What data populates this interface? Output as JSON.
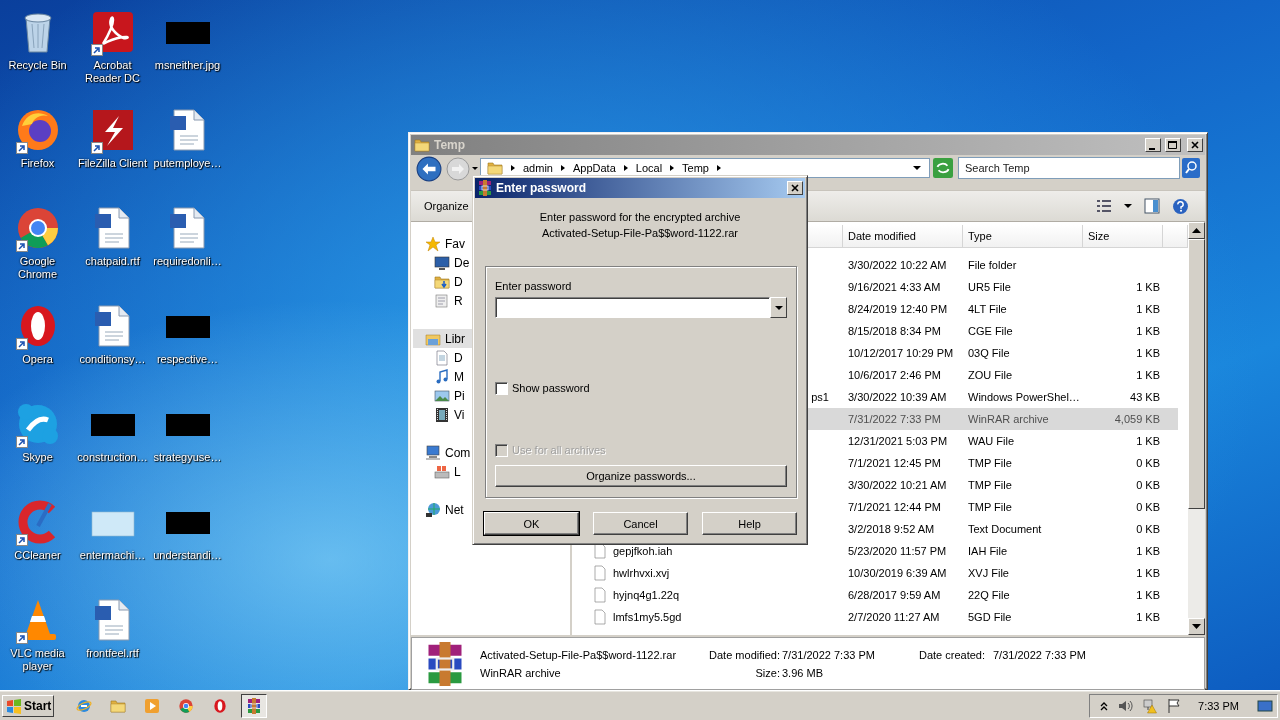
{
  "desktop": {
    "icons": [
      {
        "label": "Recycle Bin",
        "kind": "recycle",
        "shortcut": false
      },
      {
        "label": "Acrobat Reader DC",
        "kind": "acrobat",
        "shortcut": true
      },
      {
        "label": "msneither.jpg",
        "kind": "thumb",
        "shortcut": false
      },
      {
        "label": "Firefox",
        "kind": "firefox",
        "shortcut": true
      },
      {
        "label": "FileZilla Client",
        "kind": "filezilla",
        "shortcut": true
      },
      {
        "label": "putemploye…",
        "kind": "doc",
        "shortcut": false
      },
      {
        "label": "Google Chrome",
        "kind": "chrome",
        "shortcut": true
      },
      {
        "label": "chatpaid.rtf",
        "kind": "doc",
        "shortcut": false
      },
      {
        "label": "requiredonli…",
        "kind": "doc",
        "shortcut": false
      },
      {
        "label": "Opera",
        "kind": "opera",
        "shortcut": true
      },
      {
        "label": "conditionsy…",
        "kind": "doc",
        "shortcut": false
      },
      {
        "label": "respective…",
        "kind": "thumb",
        "shortcut": false
      },
      {
        "label": "Skype",
        "kind": "skype",
        "shortcut": true
      },
      {
        "label": "construction…",
        "kind": "thumb",
        "shortcut": false
      },
      {
        "label": "strategyuse…",
        "kind": "thumb",
        "shortcut": false
      },
      {
        "label": "CCleaner",
        "kind": "ccleaner",
        "shortcut": true
      },
      {
        "label": "entermachi…",
        "kind": "blank",
        "shortcut": false
      },
      {
        "label": "understandi…",
        "kind": "thumb",
        "shortcut": false
      },
      {
        "label": "VLC media player",
        "kind": "vlc",
        "shortcut": true
      },
      {
        "label": "frontfeel.rtf",
        "kind": "doc",
        "shortcut": false
      }
    ]
  },
  "explorer": {
    "title": "Temp",
    "breadcrumbs": [
      "admin",
      "AppData",
      "Local",
      "Temp"
    ],
    "search": {
      "placeholder": "Search Temp"
    },
    "toolbar": {
      "organize": "Organize"
    },
    "nav": [
      {
        "label": "Fav",
        "kind": "star",
        "selected": false,
        "children": [
          {
            "label": "De",
            "kind": "desktop",
            "selected": false
          },
          {
            "label": "D",
            "kind": "downloads",
            "selected": false
          },
          {
            "label": "R",
            "kind": "recent",
            "selected": false
          }
        ]
      },
      {
        "label": "Libr",
        "kind": "library",
        "selected": true,
        "children": [
          {
            "label": "D",
            "kind": "documents",
            "selected": false
          },
          {
            "label": "M",
            "kind": "music",
            "selected": false
          },
          {
            "label": "Pi",
            "kind": "pictures",
            "selected": false
          },
          {
            "label": "Vi",
            "kind": "videos",
            "selected": false
          }
        ]
      },
      {
        "label": "Com",
        "kind": "computer",
        "selected": false,
        "children": [
          {
            "label": "L",
            "kind": "drive",
            "selected": false
          }
        ]
      },
      {
        "label": "Net",
        "kind": "network",
        "selected": false
      }
    ],
    "columns": [
      "Date modified",
      "Type",
      "Size"
    ],
    "rows": [
      {
        "date": "3/30/2022 10:22 AM",
        "type": "File folder",
        "selected": false
      },
      {
        "date": "9/16/2021 4:33 AM",
        "type": "UR5 File",
        "size": "1 KB",
        "selected": false
      },
      {
        "date": "8/24/2019 12:40 PM",
        "type": "4LT File",
        "size": "1 KB",
        "selected": false
      },
      {
        "date": "8/15/2018 8:34 PM",
        "type": "CGE File",
        "size": "1 KB",
        "selected": false
      },
      {
        "date": "10/12/2017 10:29 PM",
        "type": "03Q File",
        "size": "1 KB",
        "selected": false
      },
      {
        "date": "10/6/2017 2:46 PM",
        "type": "ZOU File",
        "size": "1 KB",
        "selected": false
      },
      {
        "name_end": "ps1",
        "date": "3/30/2022 10:39 AM",
        "type": "Windows PowerShel…",
        "size": "43 KB",
        "selected": false
      },
      {
        "date": "7/31/2022 7:33 PM",
        "type": "WinRAR archive",
        "size": "4,059 KB",
        "selected": true
      },
      {
        "date": "12/31/2021 5:03 PM",
        "type": "WAU File",
        "size": "1 KB",
        "selected": false
      },
      {
        "date": "7/1/2021 12:45 PM",
        "type": "TMP File",
        "size": "0 KB",
        "selected": false
      },
      {
        "date": "3/30/2022 10:21 AM",
        "type": "TMP File",
        "size": "0 KB",
        "selected": false
      },
      {
        "date": "7/1/2021 12:44 PM",
        "type": "TMP File",
        "size": "0 KB",
        "selected": false
      },
      {
        "date": "3/2/2018 9:52 AM",
        "type": "Text Document",
        "size": "0 KB",
        "selected": false
      },
      {
        "name": "gepjfkoh.iah",
        "kind": "file",
        "date": "5/23/2020 11:57 PM",
        "type": "IAH File",
        "size": "1 KB",
        "selected": false
      },
      {
        "name": "hwlrhvxi.xvj",
        "kind": "file",
        "date": "10/30/2019 6:39 AM",
        "type": "XVJ File",
        "size": "1 KB",
        "selected": false
      },
      {
        "name": "hyjnq4g1.22q",
        "kind": "file",
        "date": "6/28/2017 9:59 AM",
        "type": "22Q File",
        "size": "1 KB",
        "selected": false
      },
      {
        "name": "lmfs1my5.5gd",
        "kind": "file",
        "date": "2/7/2020 11:27 AM",
        "type": "5GD File",
        "size": "1 KB",
        "selected": false
      }
    ],
    "details": {
      "name": "Activated-Setup-File-Pa$$word-1122.rar",
      "type": "WinRAR archive",
      "modified_label": "Date modified:",
      "modified": "7/31/2022 7:33 PM",
      "size_label": "Size:",
      "size": "3.96 MB",
      "created_label": "Date created:",
      "created": "7/31/2022 7:33 PM"
    }
  },
  "dialog": {
    "title": "Enter password",
    "message": "Enter password for the encrypted archive",
    "archive": "Activated-Setup-File-Pa$$word-1122.rar",
    "password_label": "Enter password",
    "checkboxes": [
      {
        "label": "Show password",
        "checked": false,
        "disabled": false
      },
      {
        "label": "Use for all archives",
        "checked": false,
        "disabled": true
      }
    ],
    "organize_button": "Organize passwords...",
    "buttons": [
      {
        "label": "OK",
        "default": true
      },
      {
        "label": "Cancel",
        "default": false
      },
      {
        "label": "Help",
        "default": false
      }
    ]
  },
  "taskbar": {
    "start": "Start",
    "apps": [
      {
        "kind": "ie",
        "active": false
      },
      {
        "kind": "folder",
        "active": false
      },
      {
        "kind": "wmp",
        "active": false
      },
      {
        "kind": "chrome",
        "active": false
      },
      {
        "kind": "opera",
        "active": false
      },
      {
        "kind": "winrar",
        "active": true
      }
    ],
    "time": "7:33 PM"
  }
}
